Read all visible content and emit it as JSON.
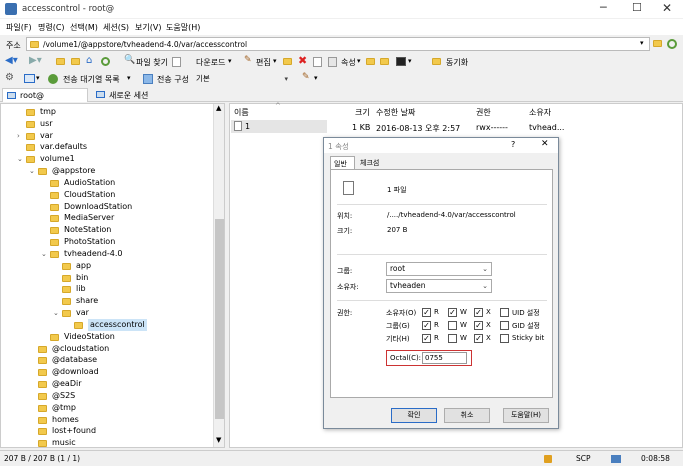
{
  "window": {
    "title": "accesscontrol - root@"
  },
  "menu": [
    "파일(F)",
    "명령(C)",
    "선택(M)",
    "세션(S)",
    "보기(V)",
    "도움말(H)"
  ],
  "address": {
    "label": "주소",
    "value": "/volume1/@appstore/tvheadend-4.0/var/accesscontrol"
  },
  "toolbar1": {
    "find": "파일 찾기",
    "download": "다운로드",
    "edit": "편집",
    "properties": "속성",
    "sync": "동기화"
  },
  "toolbar2": {
    "queue": "전송 대기열 목록",
    "transfer_config_label": "전송 구성",
    "transfer_config_value": "기본"
  },
  "tabs": {
    "session": "root@",
    "new_session": "새로운 세션"
  },
  "tree": [
    {
      "label": "tmp"
    },
    {
      "label": "usr"
    },
    {
      "label": "var"
    },
    {
      "label": "var.defaults"
    },
    {
      "label": "volume1"
    },
    {
      "label": "@appstore"
    },
    {
      "label": "AudioStation"
    },
    {
      "label": "CloudStation"
    },
    {
      "label": "DownloadStation"
    },
    {
      "label": "MediaServer"
    },
    {
      "label": "NoteStation"
    },
    {
      "label": "PhotoStation"
    },
    {
      "label": "tvheadend-4.0"
    },
    {
      "label": "app"
    },
    {
      "label": "bin"
    },
    {
      "label": "lib"
    },
    {
      "label": "share"
    },
    {
      "label": "var"
    },
    {
      "label": "accesscontrol"
    },
    {
      "label": "VideoStation"
    },
    {
      "label": "@cloudstation"
    },
    {
      "label": "@database"
    },
    {
      "label": "@download"
    },
    {
      "label": "@eaDir"
    },
    {
      "label": "@S2S"
    },
    {
      "label": "@tmp"
    },
    {
      "label": "homes"
    },
    {
      "label": "lost+found"
    },
    {
      "label": "music"
    }
  ],
  "filelist": {
    "columns": [
      "이름",
      "크기",
      "수정한 날짜",
      "권한",
      "소유자"
    ],
    "rows": [
      {
        "name": "1",
        "size": "1 KB",
        "date": "2016-08-13 오후 2:57",
        "perm": "rwx------",
        "owner": "tvhead..."
      }
    ]
  },
  "dialog": {
    "title": "1 속성",
    "help": "?",
    "tab_general": "일반",
    "tab_checksum": "체크섬",
    "file_label": "1 파일",
    "location_label": "위치:",
    "location_value": "/..../tvheadend-4.0/var/accesscontrol",
    "size_label": "크기:",
    "size_value": "207 B",
    "group_label": "그룹:",
    "group_value": "root",
    "owner_label": "소유자:",
    "owner_value": "tvheaden",
    "perm_label": "권한:",
    "perm_rows": [
      {
        "label": "소유자(O)",
        "r": true,
        "w": true,
        "x": true,
        "extra": "UID 설정",
        "extra_on": false
      },
      {
        "label": "그룹(G)",
        "r": true,
        "w": false,
        "x": true,
        "extra": "GID 설정",
        "extra_on": false
      },
      {
        "label": "기타(H)",
        "r": true,
        "w": false,
        "x": true,
        "extra": "Sticky bit",
        "extra_on": false
      }
    ],
    "r": "R",
    "w": "W",
    "x": "X",
    "octal_label": "Octal(C):",
    "octal_value": "0755",
    "ok": "확인",
    "cancel": "취소",
    "help_btn": "도움말(H)"
  },
  "status": {
    "left": "207 B / 207 B (1 / 1)",
    "protocol": "SCP",
    "time": "0:08:58"
  },
  "colors": {
    "highlight": "#cc3333",
    "selection": "#cce4f7",
    "folder": "#f2c94c"
  }
}
